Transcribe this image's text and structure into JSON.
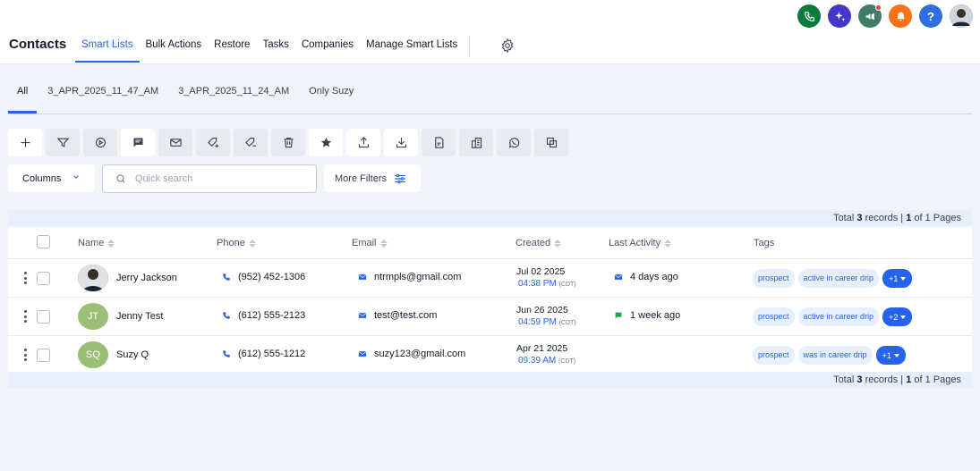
{
  "header": {
    "title": "Contacts",
    "nav": [
      "Smart Lists",
      "Bulk Actions",
      "Restore",
      "Tasks",
      "Companies",
      "Manage Smart Lists"
    ],
    "active_nav": "Smart Lists",
    "top_icons": [
      {
        "name": "phone-icon",
        "color": "#0a7c3e"
      },
      {
        "name": "sparkle-icon",
        "color": "#4338ca"
      },
      {
        "name": "megaphone-icon",
        "color": "#3f7d64"
      },
      {
        "name": "bell-icon",
        "color": "#f97316"
      },
      {
        "name": "help-icon",
        "color": "#2f6fe0",
        "text": "?"
      }
    ]
  },
  "list_tabs": [
    "All",
    "3_APR_2025_11_47_AM",
    "3_APR_2025_11_24_AM",
    "Only Suzy"
  ],
  "toolbar_icons": [
    "plus-icon",
    "filter-icon",
    "workflow-icon",
    "message-icon",
    "email-icon",
    "add-tag-icon",
    "remove-tag-icon",
    "delete-icon",
    "star-icon",
    "export-icon",
    "import-icon",
    "review-icon",
    "company-icon",
    "whatsapp-icon",
    "merge-icon"
  ],
  "filters": {
    "columns_label": "Columns",
    "search_placeholder": "Quick search",
    "more_filters_label": "More Filters"
  },
  "summary": {
    "prefix": "Total",
    "count": "3",
    "records_label": "records |",
    "page": "1",
    "pages_label": "of 1 Pages"
  },
  "table": {
    "columns": [
      "Name",
      "Phone",
      "Email",
      "Created",
      "Last Activity",
      "Tags"
    ],
    "rows": [
      {
        "name": "Jerry Jackson",
        "initials": "",
        "phone": "(952) 452-1306",
        "email": "ntrmpls@gmail.com",
        "created_date": "Jul 02 2025",
        "created_time": "04:38 PM",
        "tz": "(CDT)",
        "last_activity": "4 days ago",
        "activity_type": "email",
        "tags": [
          "prospect",
          "active in career drip"
        ],
        "more_tags": "+1"
      },
      {
        "name": "Jenny Test",
        "initials": "JT",
        "phone": "(612) 555-2123",
        "email": "test@test.com",
        "created_date": "Jun 26 2025",
        "created_time": "04:59 PM",
        "tz": "(CDT)",
        "last_activity": "1 week ago",
        "activity_type": "sms",
        "tags": [
          "prospect",
          "active in career drip"
        ],
        "more_tags": "+2"
      },
      {
        "name": "Suzy Q",
        "initials": "SQ",
        "phone": "(612) 555-1212",
        "email": "suzy123@gmail.com",
        "created_date": "Apr 21 2025",
        "created_time": "09:39 AM",
        "tz": "(CDT)",
        "last_activity": "",
        "activity_type": "",
        "tags": [
          "prospect",
          "was in career drip"
        ],
        "more_tags": "+1"
      }
    ]
  }
}
